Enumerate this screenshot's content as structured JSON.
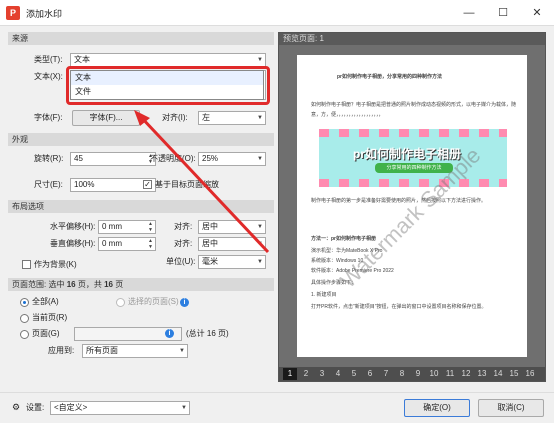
{
  "window": {
    "title": "添加水印",
    "minimize": "—",
    "maximize": "☐",
    "close": "✕"
  },
  "source": {
    "section_title": "来源",
    "type_label": "类型(T):",
    "type_value": "文本",
    "text_label": "文本(X):",
    "dropdown_options": [
      "文本",
      "文件"
    ],
    "font_label": "字体(F):",
    "font_button": "字体(F)...",
    "align_label": "对齐(I):",
    "align_value": "左"
  },
  "appearance": {
    "section_title": "外观",
    "rotate_label": "旋转(R):",
    "rotate_value": "45",
    "opacity_label": "不透明度(O):",
    "opacity_value": "25%",
    "size_label": "尺寸(E):",
    "size_value": "100%",
    "relative_label": "基于目标页面缩放",
    "relative_checked": true
  },
  "layout": {
    "section_title": "布局选项",
    "hoffset_label": "水平偏移(H):",
    "hoffset_value": "0 mm",
    "halign_label": "对齐:",
    "halign_value": "居中",
    "voffset_label": "垂直偏移(H):",
    "voffset_value": "0 mm",
    "valign_label": "对齐:",
    "valign_value": "居中",
    "background_label": "作为背景(K)",
    "unit_label": "单位(U):",
    "unit_value": "毫米"
  },
  "range": {
    "summary_prefix": "页面范围: 选中",
    "selected_pages": "16",
    "summary_mid": "页，共",
    "total_pages": "16",
    "summary_suffix": "页",
    "all_label": "全部(A)",
    "selected_label": "选择的页面(S)",
    "current_label": "当前页(R)",
    "pages_label": "页面(G)",
    "pages_total": "(总计 16 页)",
    "apply_label": "应用到:",
    "apply_value": "所有页面"
  },
  "preview": {
    "header": "预览页面: 1",
    "page_numbers": [
      "1",
      "2",
      "3",
      "4",
      "5",
      "6",
      "7",
      "8",
      "9",
      "10",
      "11",
      "12",
      "13",
      "14",
      "15",
      "16"
    ],
    "doc_heading": "pr如何制作电子相册，分享常用的四种制作方法",
    "banner_title": "pr如何制作电子相册",
    "banner_sub": "分享常用的四种制作方法",
    "watermark": "Watermark Sample",
    "method_title": "方法一：pr如何制作电子相册",
    "lines": [
      "如何制作电子相册？电子相册是把普通的照片制作成动态视频的形式，以电子媒介为载体，随",
      "意，方，便，，，，，，，，，，，，，，，，，，",
      "制作电子相册的第一步是准备好需要使用的照片，然后按照以下方法进行操作。",
      "演示机型：华为MateBook X Pro",
      "系统版本：Windows 10",
      "软件版本：Adobe Premiere Pro 2022",
      "具体操作步骤如下：",
      "1. 新建项目",
      "打开PR软件，点击\"新建项目\"按钮，在弹出的窗口中设置项目名称和保存位置。"
    ]
  },
  "bottom": {
    "settings_label": "设置:",
    "settings_value": "<自定义>",
    "ok_label": "确定(O)",
    "cancel_label": "取消(C)"
  }
}
